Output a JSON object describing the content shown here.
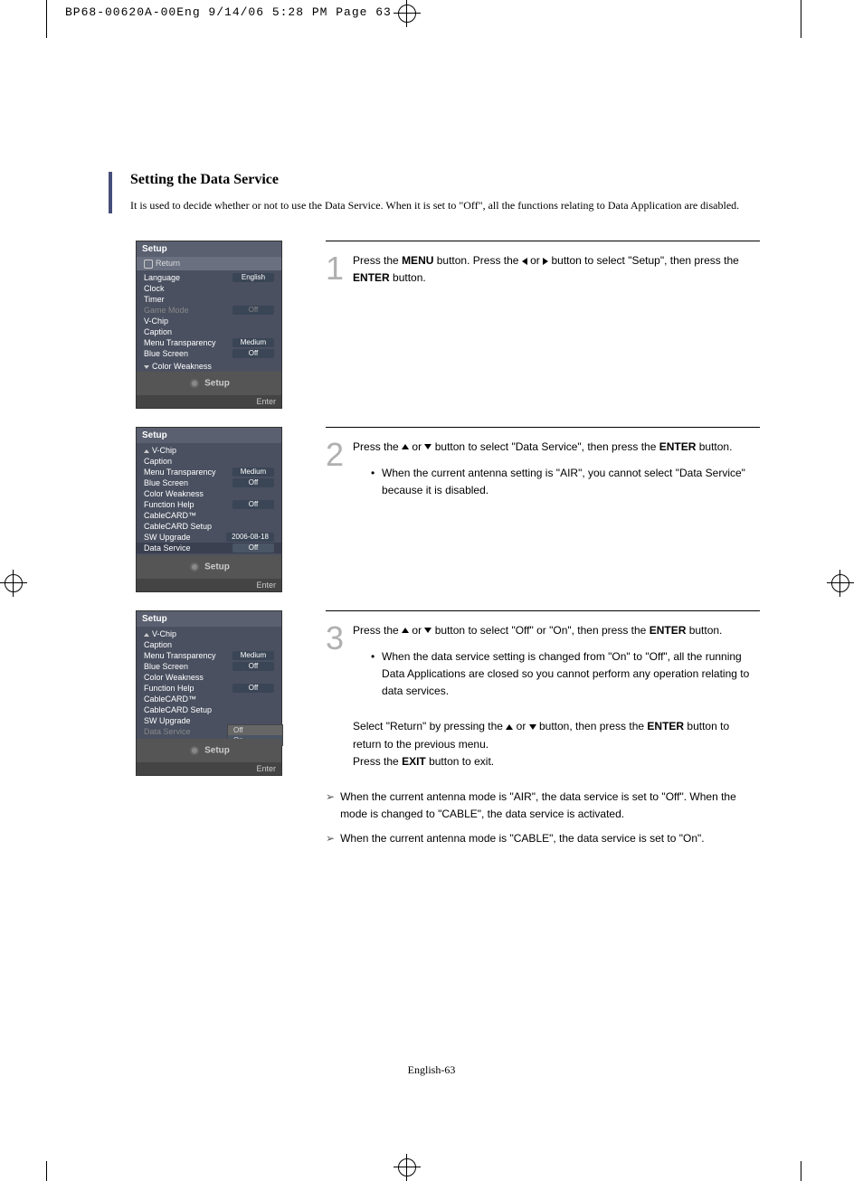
{
  "header": "BP68-00620A-00Eng  9/14/06  5:28 PM  Page 63",
  "title": "Setting the Data Service",
  "subtitle": "It is used to decide whether or not to use the Data Service. When it is set to \"Off\", all the functions relating to Data Application are disabled.",
  "menu1": {
    "title": "Setup",
    "return": "Return",
    "rows": [
      {
        "label": "Language",
        "val": "English"
      },
      {
        "label": "Clock",
        "val": ""
      },
      {
        "label": "Timer",
        "val": ""
      },
      {
        "label": "Game Mode",
        "val": "Off",
        "disabled": true
      },
      {
        "label": "V-Chip",
        "val": ""
      },
      {
        "label": "Caption",
        "val": ""
      },
      {
        "label": "Menu Transparency",
        "val": "Medium"
      },
      {
        "label": "Blue Screen",
        "val": "Off"
      }
    ],
    "more": "Color Weakness",
    "footer": "Setup",
    "enter": "Enter"
  },
  "menu2": {
    "title": "Setup",
    "rows": [
      {
        "label": "V-Chip",
        "prefix": "up"
      },
      {
        "label": "Caption",
        "val": ""
      },
      {
        "label": "Menu Transparency",
        "val": "Medium"
      },
      {
        "label": "Blue Screen",
        "val": "Off"
      },
      {
        "label": "Color Weakness",
        "val": ""
      },
      {
        "label": "Function Help",
        "val": "Off"
      },
      {
        "label": "CableCARD™",
        "val": ""
      },
      {
        "label": "CableCARD Setup",
        "val": ""
      },
      {
        "label": "SW Upgrade",
        "val": "2006-08-18"
      },
      {
        "label": "Data Service",
        "val": "Off",
        "sel": true
      }
    ],
    "footer": "Setup",
    "enter": "Enter"
  },
  "menu3": {
    "title": "Setup",
    "rows": [
      {
        "label": "V-Chip",
        "prefix": "up"
      },
      {
        "label": "Caption",
        "val": ""
      },
      {
        "label": "Menu Transparency",
        "val": "Medium"
      },
      {
        "label": "Blue Screen",
        "val": "Off"
      },
      {
        "label": "Color Weakness",
        "val": ""
      },
      {
        "label": "Function Help",
        "val": "Off"
      },
      {
        "label": "CableCARD™",
        "val": ""
      },
      {
        "label": "CableCARD Setup",
        "val": ""
      },
      {
        "label": "SW Upgrade",
        "val": ""
      },
      {
        "label": "Data Service",
        "val": "",
        "disabled": true
      }
    ],
    "submenu": [
      "Off",
      "On"
    ],
    "footer": "Setup",
    "enter": "Enter"
  },
  "step1": {
    "num": "1",
    "text_a": "Press the ",
    "text_b": "MENU",
    "text_c": " button. Press the ",
    "text_d": " or ",
    "text_e": " button to select \"Setup\", then press the ",
    "text_f": "ENTER",
    "text_g": " button."
  },
  "step2": {
    "num": "2",
    "text_a": "Press the ",
    "text_b": " or ",
    "text_c": " button to select \"Data Service\", then press the ",
    "text_d": "ENTER",
    "text_e": " button.",
    "bullet": "When the current antenna setting is \"AIR\", you cannot select \"Data Service\" because it is disabled."
  },
  "step3": {
    "num": "3",
    "text_a": "Press the ",
    "text_b": " or ",
    "text_c": " button to select \"Off\" or \"On\", then press the ",
    "text_d": "ENTER",
    "text_e": " button.",
    "bullet": "When the data service setting is changed from \"On\" to \"Off\", all the running Data Applications are closed so you cannot perform any operation relating to data services.",
    "extra_a": "Select \"Return\" by pressing the ",
    "extra_b": " or ",
    "extra_c": " button, then press the ",
    "extra_d": "ENTER",
    "extra_e": " button to return to the previous menu.",
    "extra_f": "Press the ",
    "extra_g": "EXIT",
    "extra_h": " button to exit."
  },
  "notes": [
    "When the current antenna mode is \"AIR\", the data service is set to \"Off\". When the mode is changed to \"CABLE\", the data service is activated.",
    "When the current antenna mode is \"CABLE\", the data service is set to \"On\"."
  ],
  "page_num": "English-63"
}
